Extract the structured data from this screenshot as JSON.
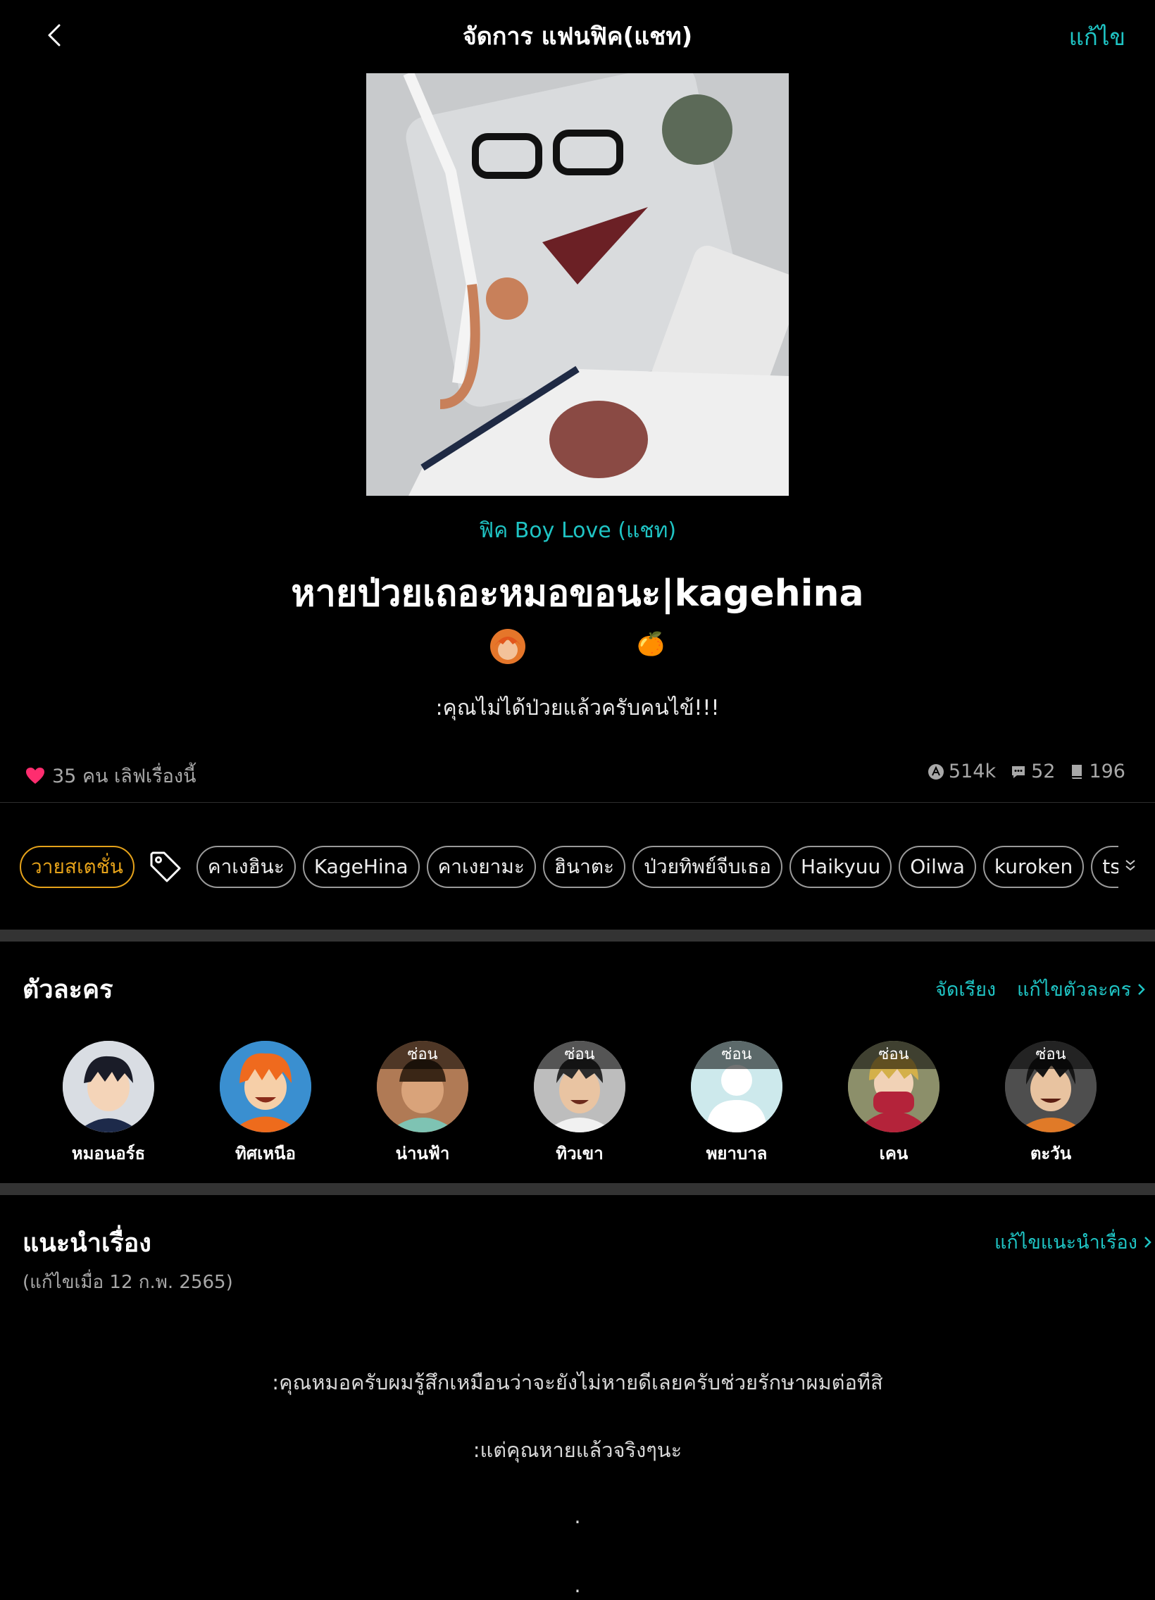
{
  "header": {
    "title": "จัดการ แฟนฟิค(แชท)",
    "edit_label": "แก้ไข"
  },
  "story": {
    "category": "ฟิค Boy Love (แชท)",
    "title": "หายป่วยเถอะหมอขอนะ|kagehina",
    "emoji": "🍊",
    "subtitle": ":คุณไม่ได้ป่วยแล้วครับคนไข้!!!",
    "likes": "35 คน เลิฟเรื่องนี้",
    "stats": {
      "views": "514k",
      "comments": "52",
      "chapters": "196"
    }
  },
  "tags": {
    "rating": "วายสเตชั่น",
    "items": [
      "คาเงฮินะ",
      "KageHina",
      "คาเงยามะ",
      "ฮินาตะ",
      "ป่วยทิพย์จีบเธอ",
      "Haikyuu",
      "Oilwa",
      "kuroken",
      "tsukiyam"
    ]
  },
  "characters": {
    "title": "ตัวละคร",
    "sort_label": "จัดเรียง",
    "edit_label": "แก้ไขตัวละคร",
    "hidden_label": "ซ่อน",
    "items": [
      {
        "name": "หมอนอร์ธ",
        "hidden": false
      },
      {
        "name": "ทิศเหนือ",
        "hidden": false
      },
      {
        "name": "น่านฟ้า",
        "hidden": true
      },
      {
        "name": "ทิวเขา",
        "hidden": true
      },
      {
        "name": "พยาบาล",
        "hidden": true
      },
      {
        "name": "เคน",
        "hidden": true
      },
      {
        "name": "ตะวัน",
        "hidden": true
      }
    ]
  },
  "intro": {
    "title": "แนะนำเรื่อง",
    "edit_label": "แก้ไขแนะนำเรื่อง",
    "edited": "(แก้ไขเมื่อ 12 ก.พ. 2565)",
    "lines": [
      ":คุณหมอครับผมรู้สึกเหมือนว่าจะยังไม่หายดีเลยครับช่วยรักษาผมต่อทีสิ",
      ":แต่คุณหายแล้วจริงๆนะ",
      ".",
      "."
    ]
  },
  "colors": {
    "accent": "#1fc4c4",
    "rating": "#e5a21a",
    "heart": "#ff2d6f",
    "background": "#000000"
  }
}
